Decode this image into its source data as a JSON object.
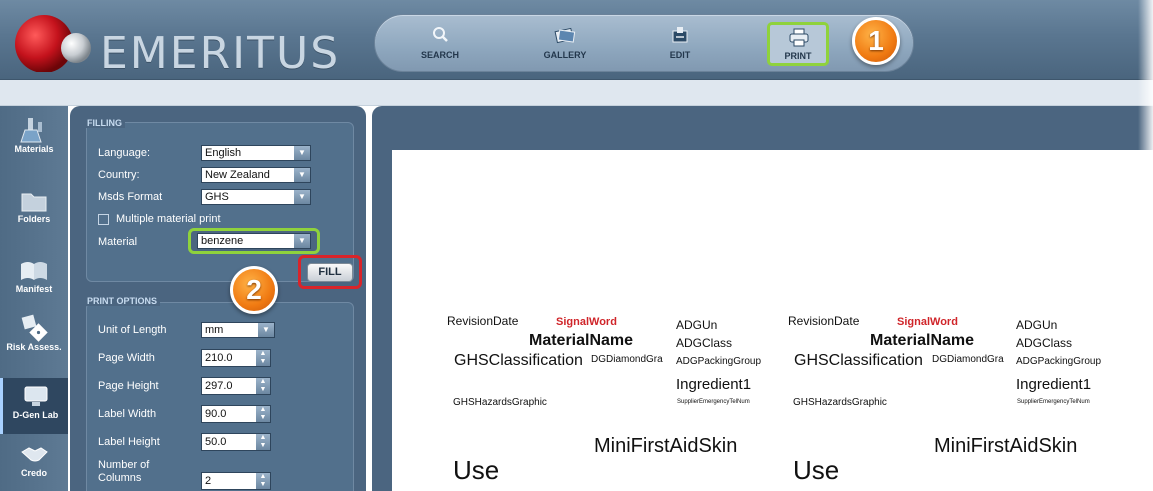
{
  "app": {
    "brand": "EMERITUS"
  },
  "toolbar": {
    "items": [
      {
        "label": "SEARCH",
        "icon": "magnifier-icon"
      },
      {
        "label": "GALLERY",
        "icon": "gallery-icon"
      },
      {
        "label": "EDIT",
        "icon": "edit-icon"
      },
      {
        "label": "PRINT",
        "icon": "printer-icon"
      }
    ]
  },
  "callouts": {
    "one": "1",
    "two": "2"
  },
  "sidebar": {
    "items": [
      {
        "label": "Materials",
        "icon": "flask-icon"
      },
      {
        "label": "Folders",
        "icon": "folder-icon"
      },
      {
        "label": "Manifest",
        "icon": "book-icon"
      },
      {
        "label": "Risk Assess.",
        "icon": "dice-icon"
      },
      {
        "label": "D-Gen Lab",
        "icon": "monitor-icon"
      },
      {
        "label": "Credo",
        "icon": "handshake-icon"
      }
    ],
    "active": "D-Gen Lab"
  },
  "filling": {
    "title": "FILLING",
    "language_label": "Language:",
    "language_value": "English",
    "country_label": "Country:",
    "country_value": "New Zealand",
    "msds_label": "Msds Format",
    "msds_value": "GHS",
    "multiple_label": "Multiple material print",
    "material_label": "Material",
    "material_value": "benzene",
    "fill_button": "FILL"
  },
  "print_options": {
    "title": "PRINT OPTIONS",
    "unit_label": "Unit of Length",
    "unit_value": "mm",
    "page_width_label": "Page Width",
    "page_width_value": "210.0",
    "page_height_label": "Page Height",
    "page_height_value": "297.0",
    "label_width_label": "Label Width",
    "label_width_value": "90.0",
    "label_height_label": "Label Height",
    "label_height_value": "50.0",
    "columns_label_1": "Number of",
    "columns_label_2": "Columns",
    "columns_value": "2"
  },
  "preview": {
    "revision_date": "RevisionDate",
    "signal_word": "SignalWord",
    "adg_un": "ADGUn",
    "material_name": "MaterialName",
    "adg_class": "ADGClass",
    "ghs_classification": "GHSClassification",
    "dg_diamond": "DGDiamondGra",
    "adg_packing": "ADGPackingGroup",
    "ingredient": "Ingredient1",
    "ghs_hazards": "GHSHazardsGraphic",
    "supplier_tel": "SupplierEmergencyTelNum",
    "first_aid": "MiniFirstAidSkin",
    "use": "Use"
  },
  "colors": {
    "accent_green": "#8fd23c",
    "accent_red": "#d9242a",
    "callout_orange": "#f07a12",
    "signal_red": "#d0252a"
  }
}
